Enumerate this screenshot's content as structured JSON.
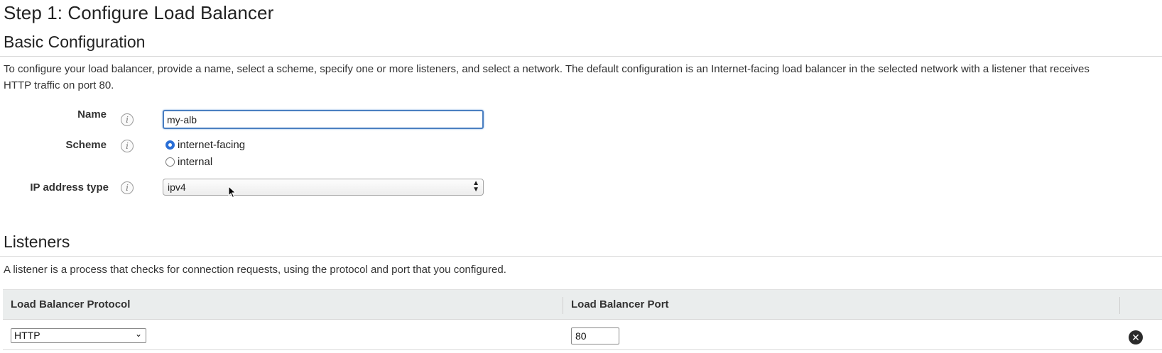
{
  "page": {
    "title": "Step 1: Configure Load Balancer"
  },
  "basic": {
    "heading": "Basic Configuration",
    "description": "To configure your load balancer, provide a name, select a scheme, specify one or more listeners, and select a network. The default configuration is an Internet-facing load balancer in the selected network with a listener that receives HTTP traffic on port 80.",
    "name_label": "Name",
    "name_value": "my-alb",
    "scheme_label": "Scheme",
    "scheme_options": [
      "internet-facing",
      "internal"
    ],
    "scheme_selected": "internet-facing",
    "ip_label": "IP address type",
    "ip_value": "ipv4",
    "info_glyph": "i"
  },
  "listeners": {
    "heading": "Listeners",
    "description": "A listener is a process that checks for connection requests, using the protocol and port that you configured.",
    "columns": [
      "Load Balancer Protocol",
      "Load Balancer Port"
    ],
    "rows": [
      {
        "protocol": "HTTP",
        "port": "80"
      }
    ]
  },
  "icons": {
    "info": "info-icon",
    "remove": "remove-circle-icon",
    "cursor": "mouse-pointer-icon"
  },
  "colors": {
    "focus_border": "#4a7fc1",
    "radio_selected": "#2a6fd6",
    "table_header_bg": "#eaeded"
  }
}
